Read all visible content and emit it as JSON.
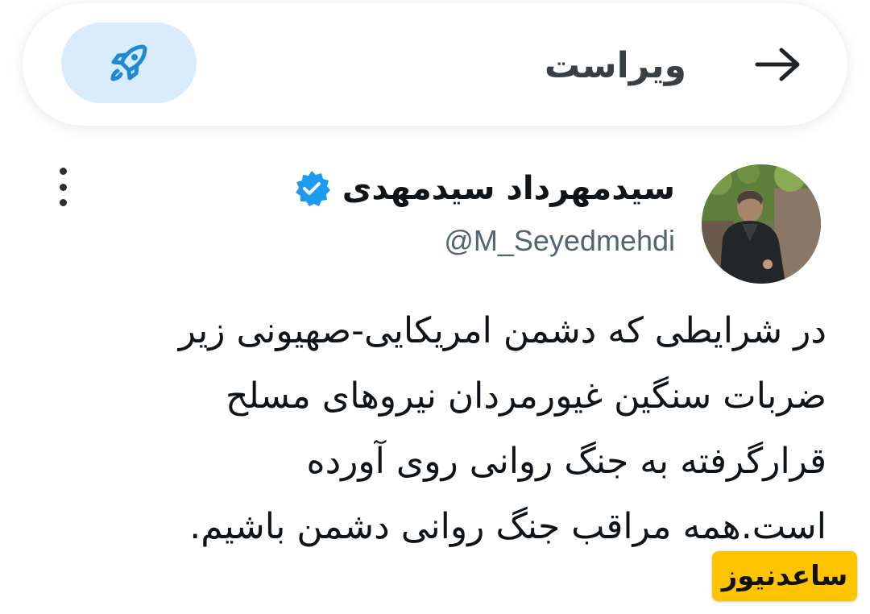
{
  "header": {
    "title": "ویراست",
    "back_icon": "arrow-right-icon",
    "boost_icon": "rocket-icon",
    "accent_color": "#1d9bf0",
    "boost_bg": "#d9ecfb"
  },
  "tweet": {
    "display_name": "سیدمهرداد سیدمهدی",
    "verified_icon": "verified-badge-icon",
    "handle": "@M_Seyedmehdi",
    "more_icon": "more-vertical-icon",
    "text_lines": [
      "در شرایطی که دشمن امریکایی-صهیونی زیر",
      "ضربات سنگین  غیورمردان نیروهای مسلح",
      "قرارگرفته به جنگ روانی روی آورده",
      "است.همه مراقب جنگ روانی دشمن باشیم."
    ]
  },
  "watermark": {
    "text": "ساعدنیوز",
    "color": "#ffc400"
  }
}
